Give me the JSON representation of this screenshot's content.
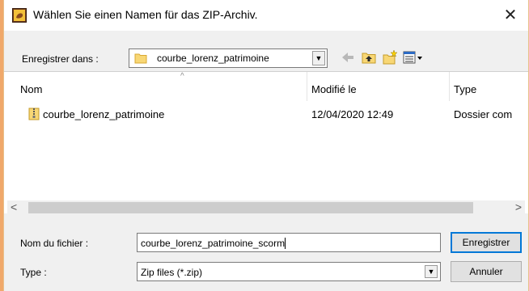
{
  "window": {
    "title": "Wählen Sie einen Namen für das ZIP-Archiv.",
    "close_glyph": "✕"
  },
  "toolbar": {
    "save_in_label": "Enregistrer dans :",
    "current_folder": "courbe_lorenz_patrimoine",
    "icons": [
      "back-arrow-icon",
      "up-folder-icon",
      "new-folder-icon",
      "view-menu-icon"
    ]
  },
  "list": {
    "columns": [
      "Nom",
      "Modifié le",
      "Type"
    ],
    "rows": [
      {
        "name": "courbe_lorenz_patrimoine",
        "modified": "12/04/2020 12:49",
        "type": "Dossier com"
      }
    ]
  },
  "form": {
    "filename_label": "Nom du fichier :",
    "filename_value": "courbe_lorenz_patrimoine_scorm",
    "type_label": "Type :",
    "type_value": "Zip files (*.zip)"
  },
  "buttons": {
    "save": "Enregistrer",
    "cancel": "Annuler"
  },
  "colors": {
    "accent": "#0078d7",
    "frame": "#f0a86a"
  }
}
